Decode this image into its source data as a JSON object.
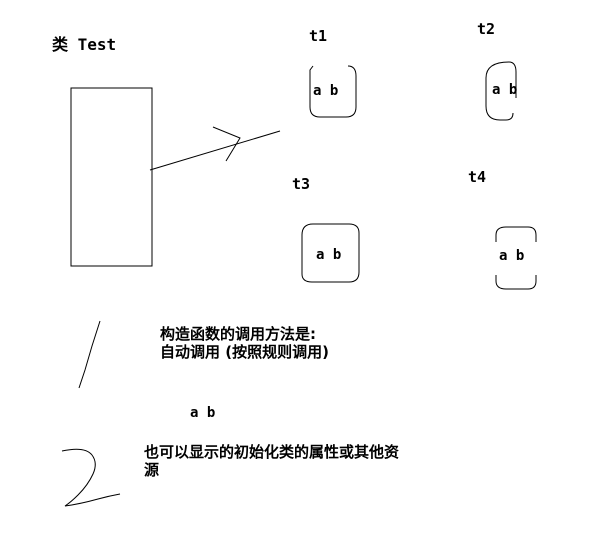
{
  "class_label": "类 Test",
  "objects": [
    {
      "name": "t1",
      "fields": "a b"
    },
    {
      "name": "t2",
      "fields": "a b"
    },
    {
      "name": "t3",
      "fields": "a b"
    },
    {
      "name": "t4",
      "fields": "a b"
    }
  ],
  "note1": {
    "line1": "构造函数的调用方法是:",
    "line2": "自动调用 (按照规则调用)"
  },
  "standalone_fields": "a b",
  "note2": {
    "line1": "也可以显示的初始化类的属性或其他资",
    "line2": "源"
  }
}
